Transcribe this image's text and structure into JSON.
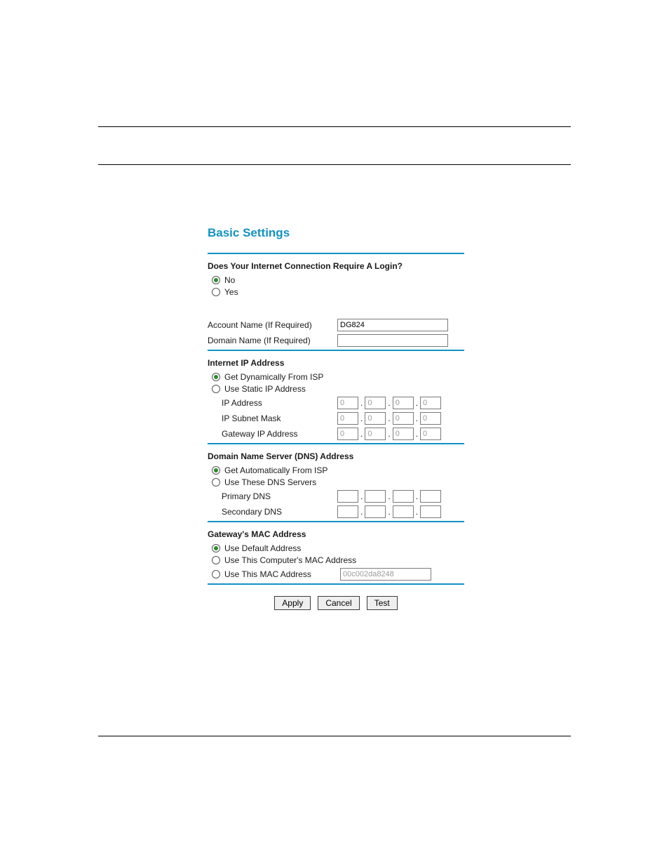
{
  "title": "Basic Settings",
  "login": {
    "question": "Does Your Internet Connection Require A Login?",
    "no": "No",
    "yes": "Yes",
    "selected": "no"
  },
  "account": {
    "account_label": "Account Name  (If Required)",
    "account_value": "DG824",
    "domain_label": "Domain Name  (If Required)",
    "domain_value": ""
  },
  "internet_ip": {
    "heading": "Internet IP Address",
    "dynamic": "Get Dynamically From ISP",
    "static": "Use Static IP Address",
    "ip_label": "IP Address",
    "mask_label": "IP Subnet Mask",
    "gw_label": "Gateway IP Address",
    "ip": [
      "0",
      "0",
      "0",
      "0"
    ],
    "mask": [
      "0",
      "0",
      "0",
      "0"
    ],
    "gw": [
      "0",
      "0",
      "0",
      "0"
    ],
    "selected": "dynamic"
  },
  "dns": {
    "heading": "Domain Name Server (DNS) Address",
    "auto": "Get Automatically From ISP",
    "use_these": "Use These DNS Servers",
    "primary_label": "Primary DNS",
    "secondary_label": "Secondary DNS",
    "primary": [
      "",
      "",
      "",
      ""
    ],
    "secondary": [
      "",
      "",
      "",
      ""
    ],
    "selected": "auto"
  },
  "mac": {
    "heading": "Gateway's MAC Address",
    "use_default": "Use Default Address",
    "use_computer": "Use This Computer's MAC Address",
    "use_this": "Use This MAC Address",
    "value": "00c002da8248",
    "selected": "default"
  },
  "buttons": {
    "apply": "Apply",
    "cancel": "Cancel",
    "test": "Test"
  }
}
